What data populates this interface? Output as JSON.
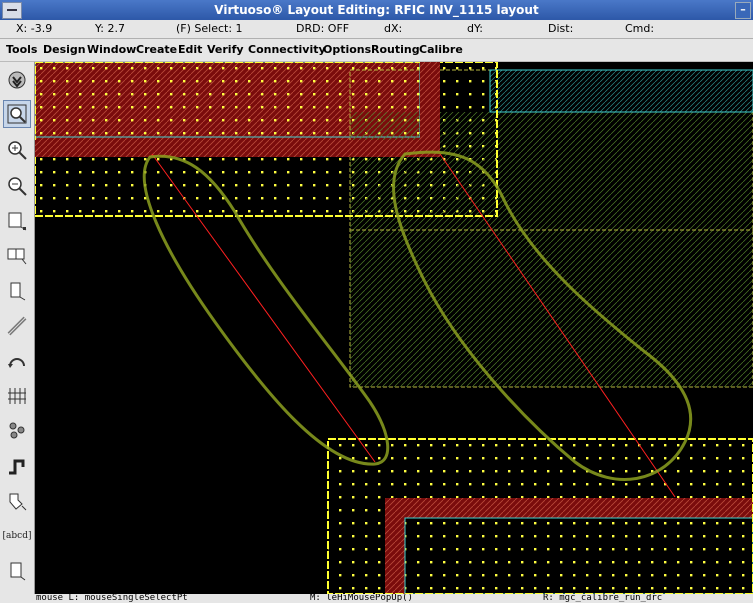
{
  "window": {
    "title": "Virtuoso® Layout Editing: RFIC INV_1115 layout"
  },
  "status": {
    "x": "X: -3.9",
    "y": "Y: 2.7",
    "select": "(F) Select: 1",
    "drd": "DRD: OFF",
    "dx": "dX:",
    "dy": "dY:",
    "dist": "Dist:",
    "cmd": "Cmd:"
  },
  "menu": [
    "Tools",
    "Design",
    "Window",
    "Create",
    "Edit",
    "Verify",
    "Connectivity",
    "Options",
    "Routing",
    "Calibre"
  ],
  "toolbar": {
    "icons": [
      "save-icon",
      "zoom-fit-icon",
      "zoom-in-icon",
      "zoom-out-icon",
      "stretch-icon",
      "copy-icon",
      "move-icon",
      "ruler-icon",
      "undo-icon",
      "align-icon",
      "property-icon",
      "path-icon",
      "polygon-icon",
      "label-icon",
      "rectangle-icon"
    ],
    "label_text": "[abcd]"
  },
  "mouse_bar": {
    "left": "mouse L: mouseSingleSelectPt",
    "middle": "M: leHiMousePopUp()",
    "right": "R: mgc_calibre_run_drc"
  },
  "colors": {
    "metal_red": "#8b1010",
    "via_dot": "#ffff40",
    "outline_yellow": "#ffff30",
    "outline_cyan": "#40d0d0",
    "annotation": "#8ca020",
    "ruler": "#ff2020"
  }
}
